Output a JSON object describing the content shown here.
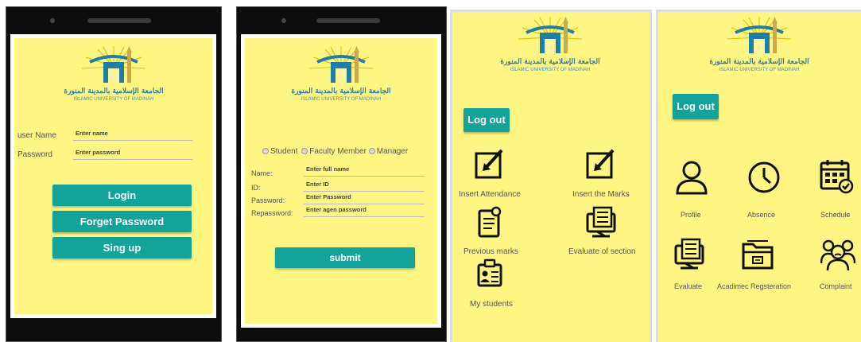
{
  "logo": {
    "arabic_text": "الجامعة الإسلامية بالمدينة المنورة",
    "english_text": "ISLAMIC UNIVERSITY OF MADINAH"
  },
  "login_screen": {
    "username_label": "user Name",
    "username_placeholder": "Enter name",
    "password_label": "Password",
    "password_placeholder": "Enter password",
    "login_button": "Login",
    "forget_button": "Forget Password",
    "signup_button": "Sing up"
  },
  "signup_screen": {
    "roles": [
      "Student",
      "Faculty Member",
      "Manager"
    ],
    "name_label": "Name:",
    "name_placeholder": "Enter  full name",
    "id_label": "ID:",
    "id_placeholder": "Enter ID",
    "password_label": "Password:",
    "password_placeholder": "Enter Password",
    "repassword_label": "Repassword:",
    "repassword_placeholder": "Enter  agen password",
    "submit_button": "submit"
  },
  "faculty_screen": {
    "logout_button": "Log out",
    "items": [
      {
        "label": "Insert Attendance",
        "icon": "edit-box-icon"
      },
      {
        "label": "Insert the Marks",
        "icon": "edit-box-icon"
      },
      {
        "label": "Previous marks",
        "icon": "document-icon"
      },
      {
        "label": "Evaluate of section",
        "icon": "monitor-checklist-icon"
      },
      {
        "label": "My students",
        "icon": "id-card-icon"
      }
    ]
  },
  "student_screen": {
    "logout_button": "Log out",
    "items": [
      {
        "label": "Profile",
        "icon": "user-icon"
      },
      {
        "label": "Absence",
        "icon": "clock-icon"
      },
      {
        "label": "Schedule",
        "icon": "calendar-check-icon"
      },
      {
        "label": "Evaluate",
        "icon": "monitor-checklist-icon"
      },
      {
        "label": "Acadimec Regsteration",
        "icon": "folder-icon"
      },
      {
        "label": "Complaint",
        "icon": "people-icon"
      }
    ]
  },
  "colors": {
    "screen_bg": "#fff582",
    "accent": "#14a39a",
    "phone_body": "#0d0d0d"
  }
}
